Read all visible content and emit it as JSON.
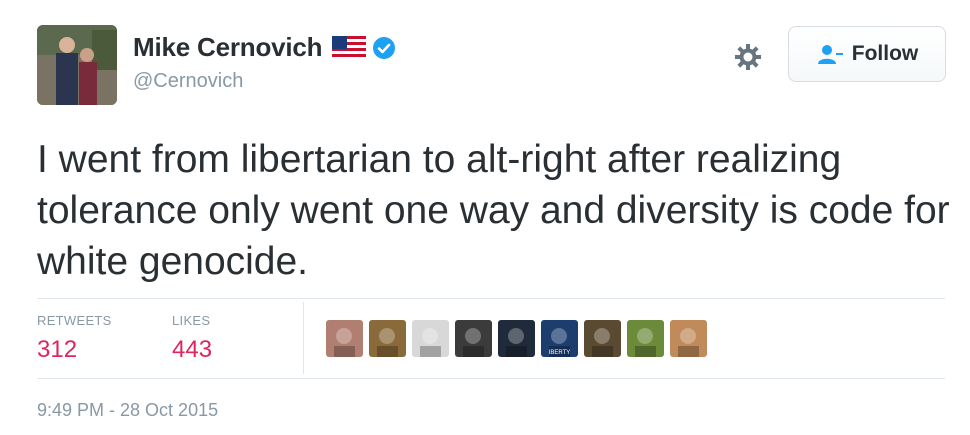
{
  "user": {
    "display_name": "Mike Cernovich",
    "handle": "@Cernovich",
    "avatar_icon": "profile-photo",
    "flag_icon": "us-flag-icon",
    "verified_icon": "verified-badge-icon"
  },
  "actions": {
    "follow_label": "Follow",
    "gear_icon": "gear-icon",
    "follow_icon": "add-user-icon"
  },
  "tweet": {
    "text": "I went from libertarian to alt-right after realizing tolerance only went one way and diversity is code for white genocide."
  },
  "stats": {
    "retweets_label": "RETWEETS",
    "retweets_value": "312",
    "likes_label": "LIKES",
    "likes_value": "443"
  },
  "likers": [
    {
      "name": "liker-1",
      "color": "#b07f72"
    },
    {
      "name": "liker-2",
      "color": "#8a6a3a"
    },
    {
      "name": "liker-3",
      "color": "#d8d8d8"
    },
    {
      "name": "liker-4",
      "color": "#3b3b3b"
    },
    {
      "name": "liker-5",
      "color": "#1f2a3a"
    },
    {
      "name": "liker-6",
      "color": "#1c3d6e",
      "caption": "IBERTY"
    },
    {
      "name": "liker-7",
      "color": "#5a4a32"
    },
    {
      "name": "liker-8",
      "color": "#6b8a3a"
    },
    {
      "name": "liker-9",
      "color": "#c08a5a"
    }
  ],
  "timestamp": "9:49 PM - 28 Oct 2015",
  "colors": {
    "text": "#292f33",
    "muted": "#8899a6",
    "like_red": "#e0245e",
    "verified_blue": "#1da1f2",
    "divider": "#e1e8ed"
  }
}
